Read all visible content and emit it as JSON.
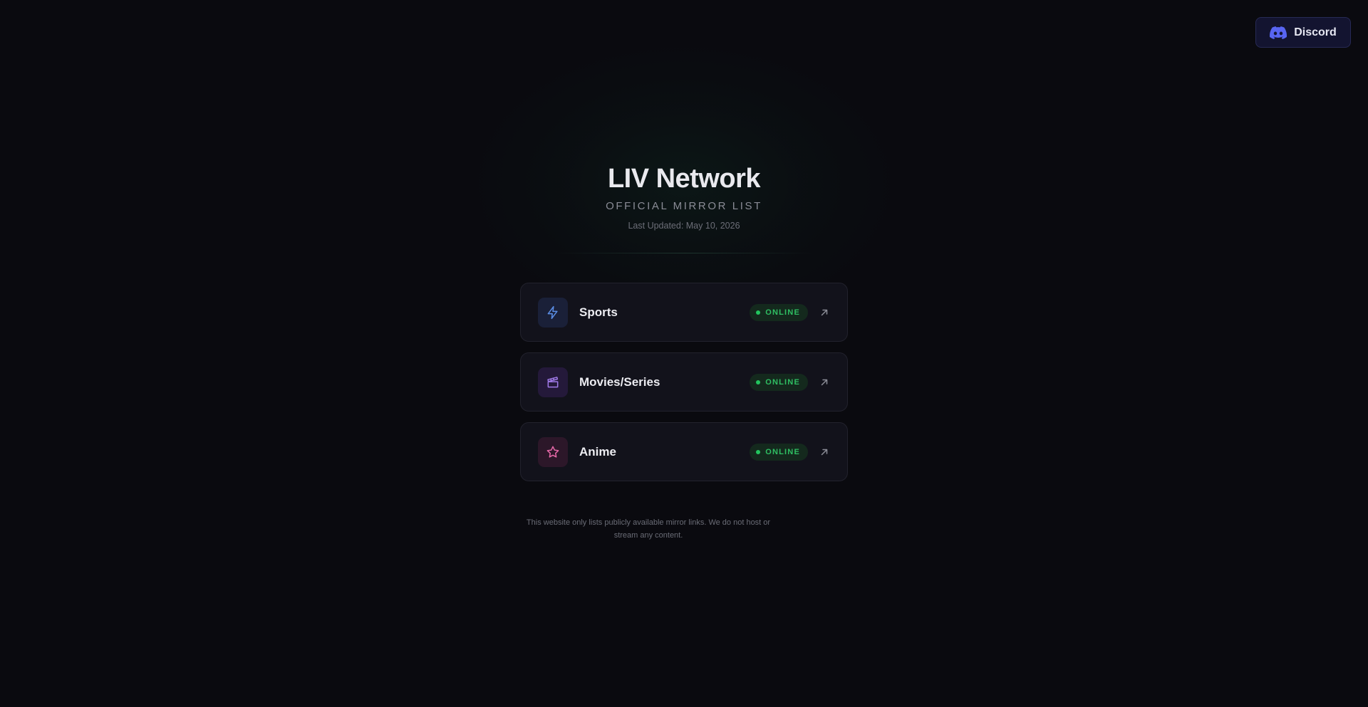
{
  "header": {
    "discord_label": "Discord"
  },
  "hero": {
    "title": "LIV Network",
    "subtitle": "OFFICIAL MIRROR LIST",
    "last_updated": "Last Updated: May 10, 2026"
  },
  "mirrors": [
    {
      "name": "Sports",
      "status": "ONLINE",
      "icon": "lightning-icon",
      "accent": "#5b8ee6"
    },
    {
      "name": "Movies/Series",
      "status": "ONLINE",
      "icon": "clapperboard-icon",
      "accent": "#a07ae8"
    },
    {
      "name": "Anime",
      "status": "ONLINE",
      "icon": "star-icon",
      "accent": "#e668a8"
    }
  ],
  "footer": {
    "disclaimer": "This website only lists publicly available mirror links. We do not host or stream any content."
  },
  "colors": {
    "background": "#0a0a0f",
    "online": "#22c55e",
    "discord": "#5865f2"
  }
}
